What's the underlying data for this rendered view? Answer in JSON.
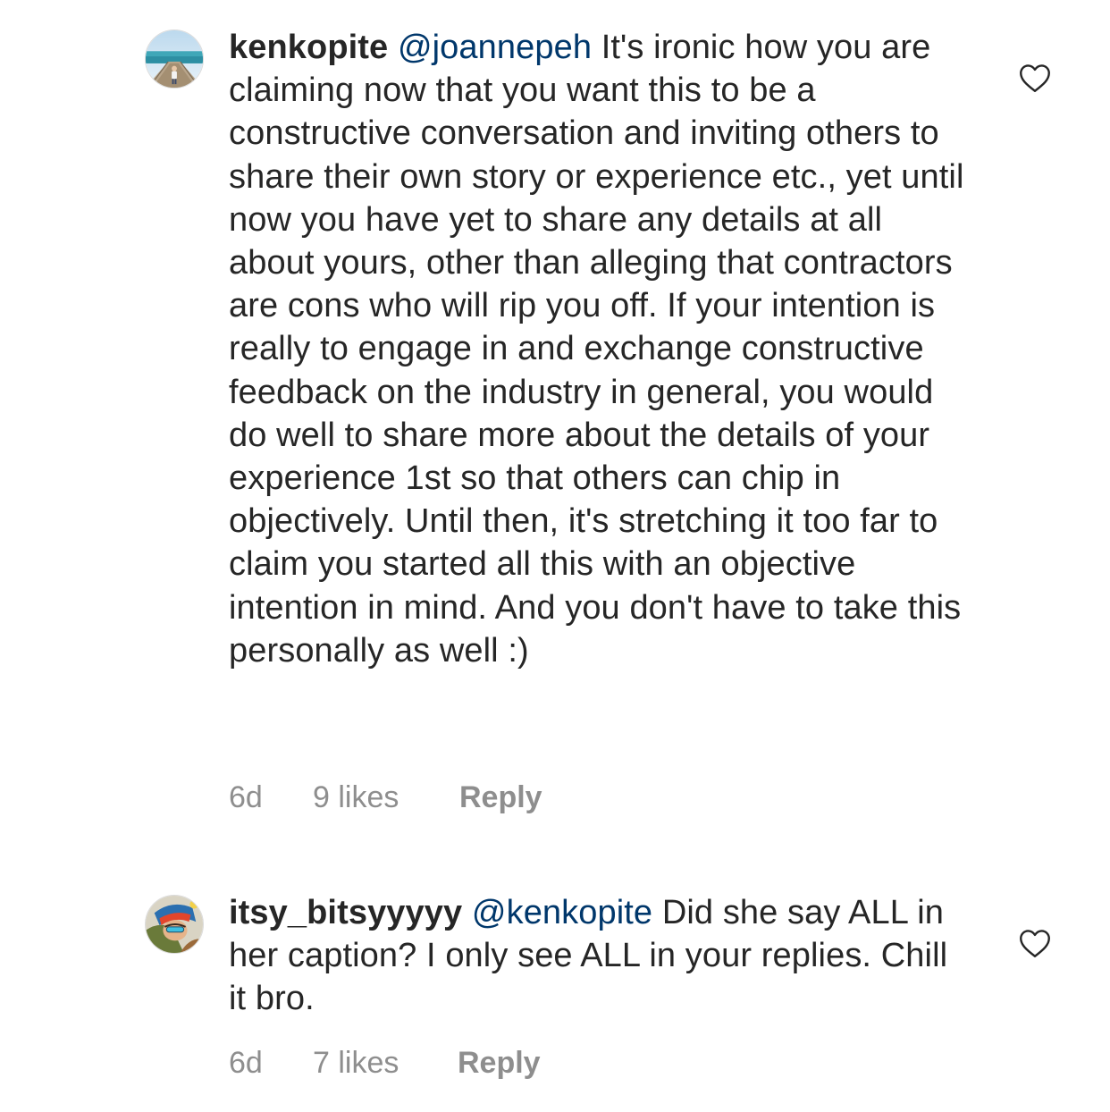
{
  "comments": [
    {
      "username": "kenkopite",
      "mention": "@joannepeh",
      "text": "It's ironic how you are claiming now that you want this to be a constructive conversation and inviting others to share their own story or experience etc., yet until now you have yet to share any details at all about yours, other than alleging that contractors are cons who will rip you off. If your intention is really to engage in and exchange constructive feedback on the industry in general, you would do well to share more about the details of your experience 1st so that others  can chip in objectively. Until then, it's  stretching it too far to claim you started all this with an objective intention in mind. And you don't have to take this personally as well :)",
      "time": "6d",
      "likes": "9 likes",
      "reply": "Reply",
      "avatar_icon": "beach-boardwalk-avatar",
      "like_icon": "heart-outline-icon"
    },
    {
      "username": "itsy_bitsyyyyy",
      "mention": "@kenkopite",
      "text": "Did she say ALL in her caption? I only see ALL in your replies. Chill it bro.",
      "time": "6d",
      "likes": "7 likes",
      "reply": "Reply",
      "avatar_icon": "cartoon-avatar",
      "like_icon": "heart-outline-icon"
    }
  ],
  "colors": {
    "text": "#262626",
    "mention": "#00376b",
    "secondary": "#8e8e8e",
    "background": "#ffffff"
  }
}
